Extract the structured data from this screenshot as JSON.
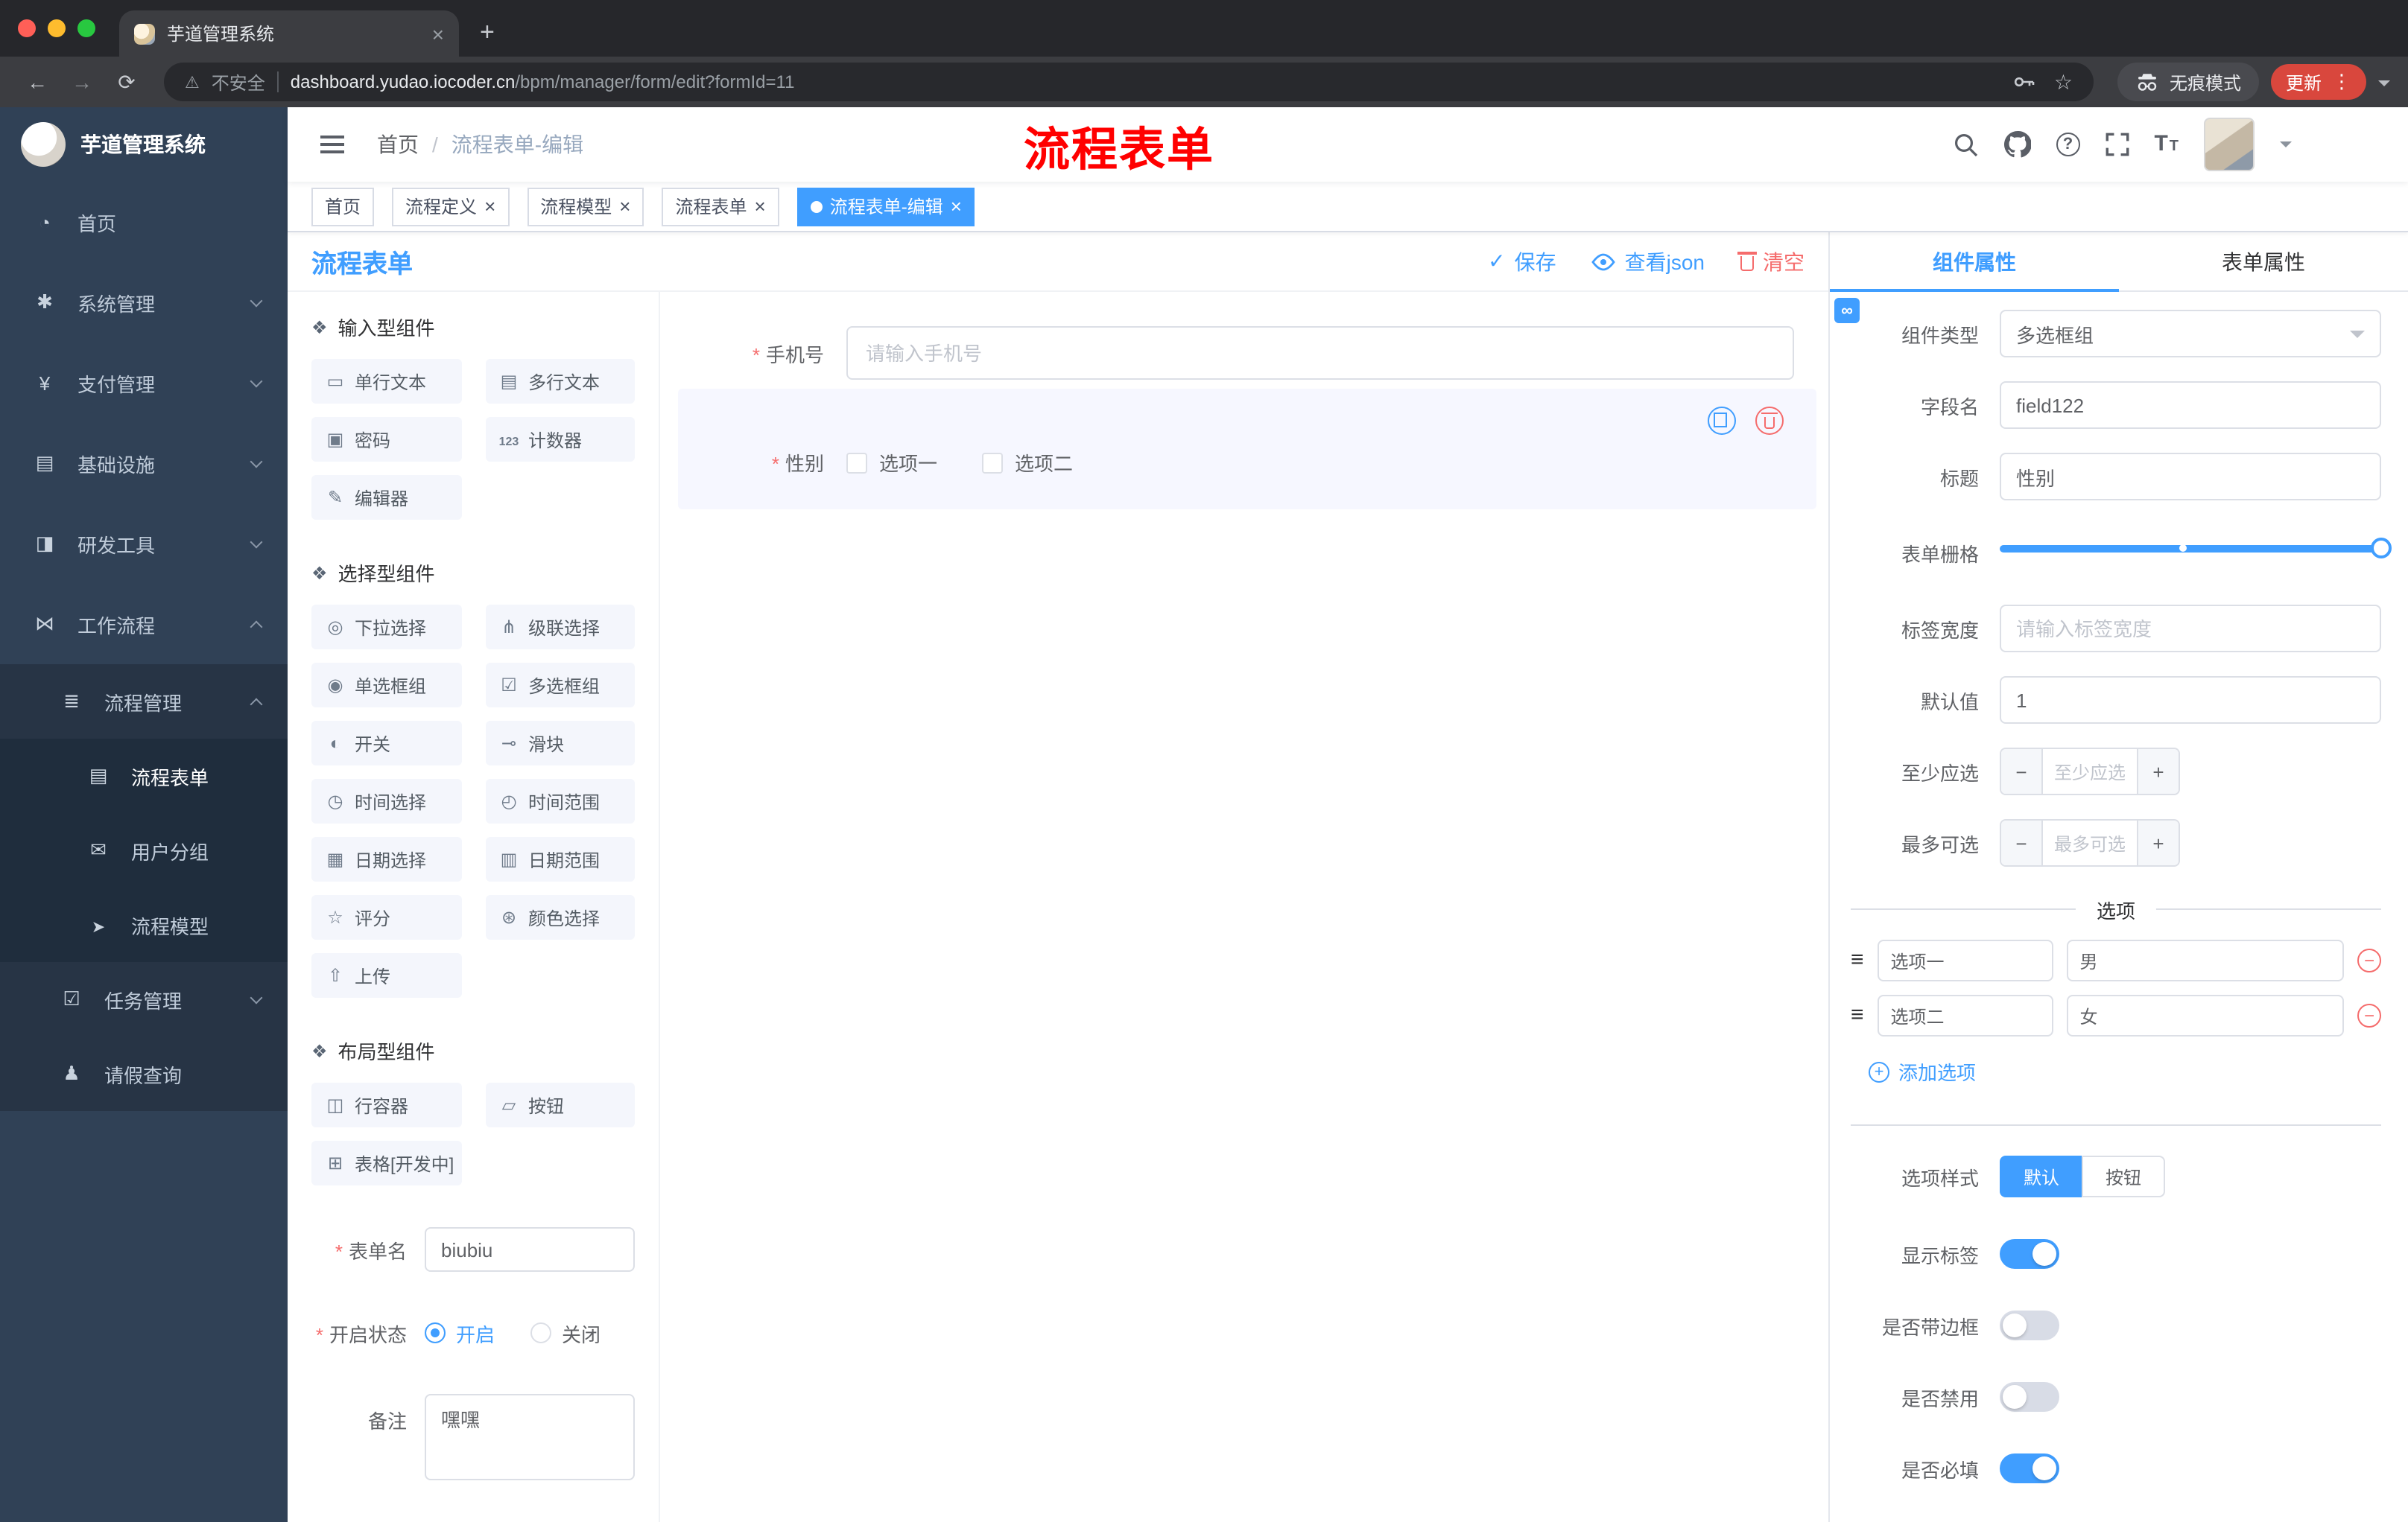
{
  "colors": {
    "accent": "#409EFF",
    "danger": "#F56C6C",
    "annotation_red": "#FF0000",
    "sidebar_bg": "#304156",
    "sidebar_submenu_bg": "#273445",
    "sidebar_deep_bg": "#1F2D3D",
    "active_tag_bg": "#409EFF",
    "update_pill_bg": "#D9473D",
    "selected_item_bg": "#F6F7FF"
  },
  "browser": {
    "tab": {
      "title": "芋道管理系统",
      "favicon": "yudao-favicon"
    },
    "toolbar": {
      "security_label": "不安全",
      "url_domain": "dashboard.yudao.iocoder.cn",
      "url_path": "/bpm/manager/form/edit?formId=11",
      "incognito_label": "无痕模式",
      "update_label": "更新"
    }
  },
  "sidebar": {
    "logo_title": "芋道管理系统",
    "items": [
      {
        "label": "首页",
        "icon": "dashboard-icon"
      },
      {
        "label": "系统管理",
        "icon": "gear-icon"
      },
      {
        "label": "支付管理",
        "icon": "payment-icon"
      },
      {
        "label": "基础设施",
        "icon": "infrastructure-icon"
      },
      {
        "label": "研发工具",
        "icon": "dev-tools-icon"
      },
      {
        "label": "工作流程",
        "icon": "workflow-icon"
      }
    ],
    "process_management": {
      "label": "流程管理",
      "icon": "process-management-icon"
    },
    "process_children": [
      {
        "label": "流程表单",
        "icon": "form-icon",
        "active": true
      },
      {
        "label": "用户分组",
        "icon": "user-group-icon"
      },
      {
        "label": "流程模型",
        "icon": "model-icon"
      }
    ],
    "task_management": {
      "label": "任务管理",
      "icon": "task-icon"
    },
    "leave_query": {
      "label": "请假查询",
      "icon": "person-icon"
    }
  },
  "navbar": {
    "breadcrumb": [
      "首页",
      "流程表单-编辑"
    ],
    "annotation": "流程表单",
    "icons": [
      "search-icon",
      "github-icon",
      "question-icon",
      "fullscreen-icon",
      "font-size-icon",
      "avatar",
      "caret-down-icon"
    ]
  },
  "tags": [
    {
      "label": "首页",
      "closable": false,
      "active": false
    },
    {
      "label": "流程定义",
      "closable": true,
      "active": false
    },
    {
      "label": "流程模型",
      "closable": true,
      "active": false
    },
    {
      "label": "流程表单",
      "closable": true,
      "active": false
    },
    {
      "label": "流程表单-编辑",
      "closable": true,
      "active": true
    }
  ],
  "editor": {
    "title": "流程表单",
    "save_label": "保存",
    "view_json_label": "查看json",
    "clear_label": "清空"
  },
  "palette": {
    "sections": [
      {
        "title": "输入型组件",
        "items": [
          {
            "label": "单行文本",
            "icon": "text-field-icon"
          },
          {
            "label": "多行文本",
            "icon": "textarea-icon"
          },
          {
            "label": "密码",
            "icon": "password-icon"
          },
          {
            "label": "计数器",
            "icon": "counter-icon"
          },
          {
            "label": "编辑器",
            "icon": "editor-icon"
          }
        ]
      },
      {
        "title": "选择型组件",
        "items": [
          {
            "label": "下拉选择",
            "icon": "select-icon"
          },
          {
            "label": "级联选择",
            "icon": "cascader-icon"
          },
          {
            "label": "单选框组",
            "icon": "radio-group-icon"
          },
          {
            "label": "多选框组",
            "icon": "checkbox-group-icon"
          },
          {
            "label": "开关",
            "icon": "switch-icon"
          },
          {
            "label": "滑块",
            "icon": "slider-icon"
          },
          {
            "label": "时间选择",
            "icon": "time-picker-icon"
          },
          {
            "label": "时间范围",
            "icon": "time-range-icon"
          },
          {
            "label": "日期选择",
            "icon": "date-picker-icon"
          },
          {
            "label": "日期范围",
            "icon": "date-range-icon"
          },
          {
            "label": "评分",
            "icon": "rate-icon"
          },
          {
            "label": "颜色选择",
            "icon": "color-picker-icon"
          },
          {
            "label": "上传",
            "icon": "upload-icon"
          }
        ]
      },
      {
        "title": "布局型组件",
        "items": [
          {
            "label": "行容器",
            "icon": "row-container-icon"
          },
          {
            "label": "按钮",
            "icon": "button-icon"
          },
          {
            "label": "表格[开发中]",
            "icon": "table-icon"
          }
        ]
      }
    ]
  },
  "form_meta": {
    "form_name": {
      "label": "表单名",
      "value": "biubiu",
      "required": true
    },
    "status": {
      "label": "开启状态",
      "on_label": "开启",
      "off_label": "关闭",
      "selected": "开启",
      "required": true
    },
    "remark": {
      "label": "备注",
      "value": "嘿嘿"
    }
  },
  "canvas": {
    "phone_field": {
      "label": "手机号",
      "placeholder": "请输入手机号",
      "required": true
    },
    "gender_field": {
      "label": "性别",
      "required": true,
      "option1": "选项一",
      "option2": "选项二",
      "selected": true
    }
  },
  "props": {
    "tab_component": "组件属性",
    "tab_form": "表单属性",
    "rows": {
      "component_type": {
        "label": "组件类型",
        "value": "多选框组"
      },
      "field_name": {
        "label": "字段名",
        "value": "field122"
      },
      "title": {
        "label": "标题",
        "value": "性别"
      },
      "form_grid": {
        "label": "表单栅格"
      },
      "label_width": {
        "label": "标签宽度",
        "placeholder": "请输入标签宽度"
      },
      "default_value": {
        "label": "默认值",
        "value": "1"
      },
      "min_select": {
        "label": "至少应选",
        "placeholder": "至少应选"
      },
      "max_select": {
        "label": "最多可选",
        "placeholder": "最多可选"
      }
    },
    "options_section": {
      "divider_title": "选项",
      "options": [
        {
          "label": "选项一",
          "value": "男"
        },
        {
          "label": "选项二",
          "value": "女"
        }
      ],
      "add_label": "添加选项"
    },
    "option_style": {
      "label": "选项样式",
      "choice_default": "默认",
      "choice_button": "按钮",
      "selected": "默认"
    },
    "switches": [
      {
        "label": "显示标签",
        "on": true
      },
      {
        "label": "是否带边框",
        "on": false
      },
      {
        "label": "是否禁用",
        "on": false
      },
      {
        "label": "是否必填",
        "on": true
      }
    ]
  }
}
